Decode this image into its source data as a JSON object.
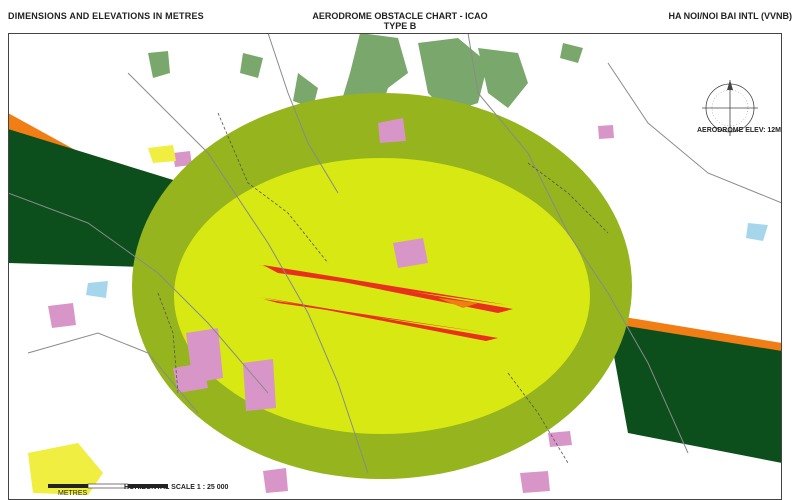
{
  "header": {
    "left": "DIMENSIONS AND ELEVATIONS IN METRES",
    "title_line1": "AERODROME OBSTACLE CHART - ICAO",
    "title_line2": "TYPE B",
    "right": "HA NOI/NOI BAI INTL (VVNB)"
  },
  "aerodrome_elev": "AERODROME ELEV: 12M",
  "scale_label": "HORIZONTAL SCALE 1 : 25 000",
  "scale_unit": "METRES",
  "colors": {
    "outer_zone": "#96b41e",
    "inner_zone": "#d8e812",
    "approach_surface": "#0c4e1c",
    "corridor_orange": "#f07e14",
    "runway_red": "#e8301c",
    "forest": "#7aa86c",
    "urban_pink": "#d896c8",
    "water_blue": "#a6d6ec",
    "yellow_patch": "#f0ee40"
  },
  "icons": [
    "compass-rose-icon"
  ]
}
